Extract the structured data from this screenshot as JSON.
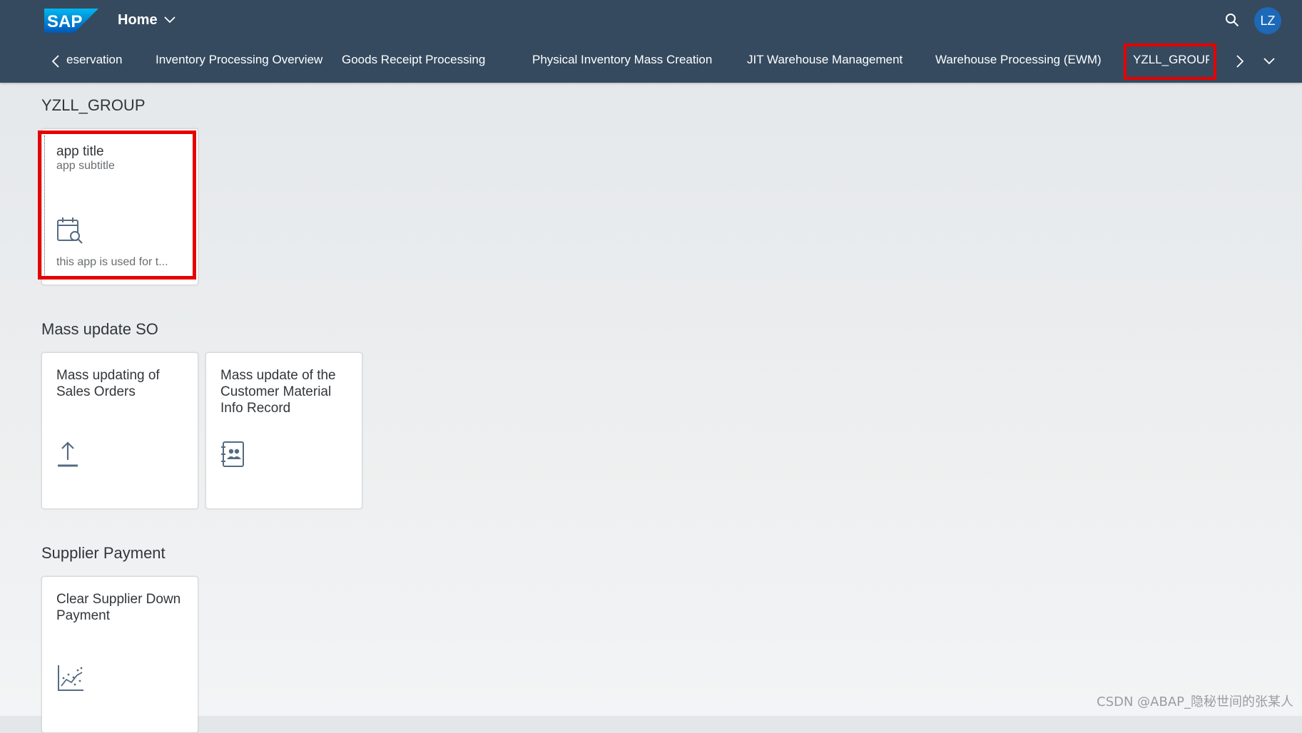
{
  "header": {
    "logo_text": "SAP",
    "home_label": "Home",
    "search_icon": "search-icon",
    "avatar_initials": "LZ"
  },
  "tabs": [
    {
      "label": "Reservation",
      "visible_text": "eservation"
    },
    {
      "label": "Inventory Processing Overview"
    },
    {
      "label": "Goods Receipt Processing"
    },
    {
      "label": "Physical Inventory Mass Creation"
    },
    {
      "label": "JIT Warehouse Management"
    },
    {
      "label": "Warehouse Processing (EWM)"
    },
    {
      "label": "YZLL_GROUP",
      "selected": true
    }
  ],
  "groups": [
    {
      "title": "YZLL_GROUP",
      "tiles": [
        {
          "title": "app title",
          "subtitle": "app subtitle",
          "icon": "calendar-search-icon",
          "footer": "this app is used for t..."
        }
      ]
    },
    {
      "title": "Mass update SO",
      "tiles": [
        {
          "title": "Mass updating of Sales Orders",
          "icon": "upload-icon"
        },
        {
          "title": "Mass update of the Customer Material Info Record",
          "icon": "address-book-icon"
        }
      ]
    },
    {
      "title": "Supplier Payment",
      "tiles": [
        {
          "title": "Clear Supplier Down Payment",
          "icon": "scatter-chart-icon"
        }
      ]
    }
  ],
  "watermark": "CSDN @ABAP_隐秘世间的张某人",
  "colors": {
    "shell": "#354a5f",
    "avatar": "#1c69b8",
    "highlight": "#e60000",
    "icon": "#556b82"
  }
}
